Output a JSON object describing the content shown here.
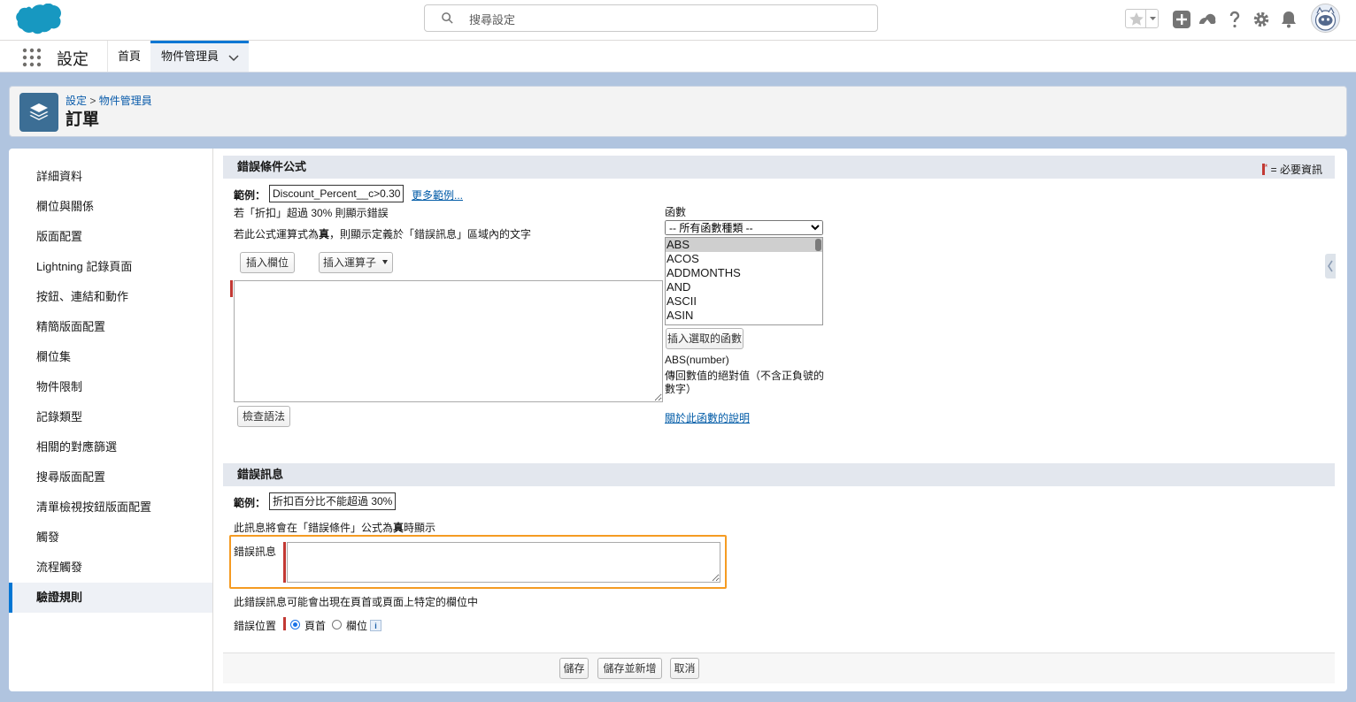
{
  "global_header": {
    "search_placeholder": "搜尋設定"
  },
  "nav": {
    "app_name": "設定",
    "tabs": [
      {
        "label": "首頁"
      },
      {
        "label": "物件管理員"
      }
    ]
  },
  "page_header": {
    "breadcrumb": [
      "設定",
      "物件管理員"
    ],
    "breadcrumb_sep": ">",
    "title": "訂單"
  },
  "sidebar": {
    "items": [
      {
        "label": "詳細資料"
      },
      {
        "label": "欄位與關係"
      },
      {
        "label": "版面配置"
      },
      {
        "label": "Lightning 記錄頁面"
      },
      {
        "label": "按鈕、連結和動作"
      },
      {
        "label": "精簡版面配置"
      },
      {
        "label": "欄位集"
      },
      {
        "label": "物件限制"
      },
      {
        "label": "記錄類型"
      },
      {
        "label": "相關的對應篩選"
      },
      {
        "label": "搜尋版面配置"
      },
      {
        "label": "清單檢視按鈕版面配置"
      },
      {
        "label": "觸發"
      },
      {
        "label": "流程觸發"
      },
      {
        "label": "驗證規則",
        "active": true
      }
    ]
  },
  "formula_section": {
    "title": "錯誤條件公式",
    "required_note": "= 必要資訊",
    "required_mark": "*",
    "example_label": "範例：",
    "example_value": "Discount_Percent__c>0.30",
    "more_examples": "更多範例...",
    "example_desc": "若「折扣」超過 30% 則顯示錯誤",
    "help_prefix": "若此公式運算式為",
    "help_true": "真",
    "help_suffix": "，則顯示定義於「錯誤訊息」區域內的文字",
    "insert_field_btn": "插入欄位",
    "insert_operator_btn": "插入運算子",
    "check_syntax_btn": "檢查語法",
    "formula_value": "",
    "functions_label": "函數",
    "function_category": "-- 所有函數種類 --",
    "functions": [
      "ABS",
      "ACOS",
      "ADDMONTHS",
      "AND",
      "ASCII",
      "ASIN"
    ],
    "selected_function": "ABS",
    "insert_function_btn": "插入選取的函數",
    "function_signature": "ABS(number)",
    "function_desc": "傳回數值的絕對值（不含正負號的數字）",
    "function_help_link": "關於此函數的說明"
  },
  "error_section": {
    "title": "錯誤訊息",
    "example_label": "範例：",
    "example_value": "折扣百分比不能超過 30%",
    "desc_prefix": "此訊息將會在「錯誤條件」公式為",
    "desc_true": "真",
    "desc_suffix": "時顯示",
    "message_label": "錯誤訊息",
    "message_value": "",
    "location_desc": "此錯誤訊息可能會出現在頁首或頁面上特定的欄位中",
    "location_label": "錯誤位置",
    "location_options": [
      {
        "label": "頁首",
        "checked": true
      },
      {
        "label": "欄位",
        "checked": false
      }
    ],
    "info_icon": "i"
  },
  "footer": {
    "save": "儲存",
    "save_new": "儲存並新增",
    "cancel": "取消"
  },
  "colors": {
    "brand": "#0176d3",
    "required": "#c23934",
    "highlight": "#f59b22",
    "object_icon": "#3c6e95"
  }
}
